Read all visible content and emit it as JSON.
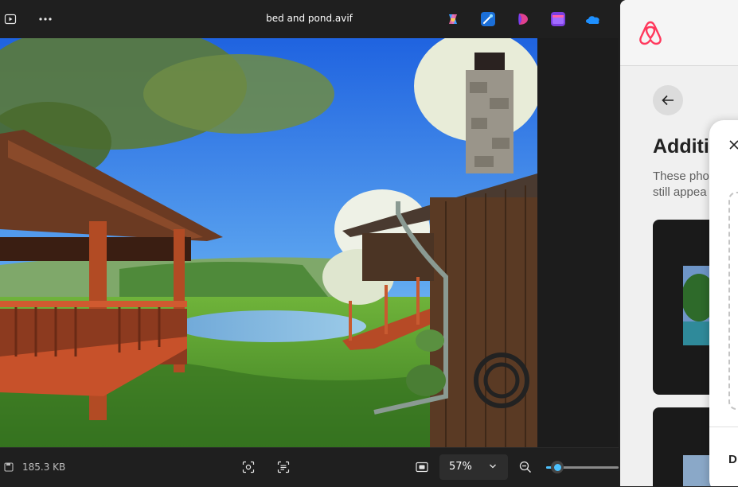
{
  "viewer": {
    "title": "bed and pond.avif",
    "filesize": "185.3 KB",
    "zoom": "57%",
    "zoom_slider_fraction": 0.15,
    "app_icons": [
      "copilot-icon",
      "designer-icon",
      "clipchamp-icon",
      "video-editor-icon",
      "onedrive-icon"
    ]
  },
  "airbnb": {
    "heading": "Additi",
    "description": [
      "These pho",
      "still appea"
    ],
    "modal_action": "D",
    "brand_color": "#ff385c"
  },
  "colors": {
    "accent": "#4cc2ff"
  }
}
